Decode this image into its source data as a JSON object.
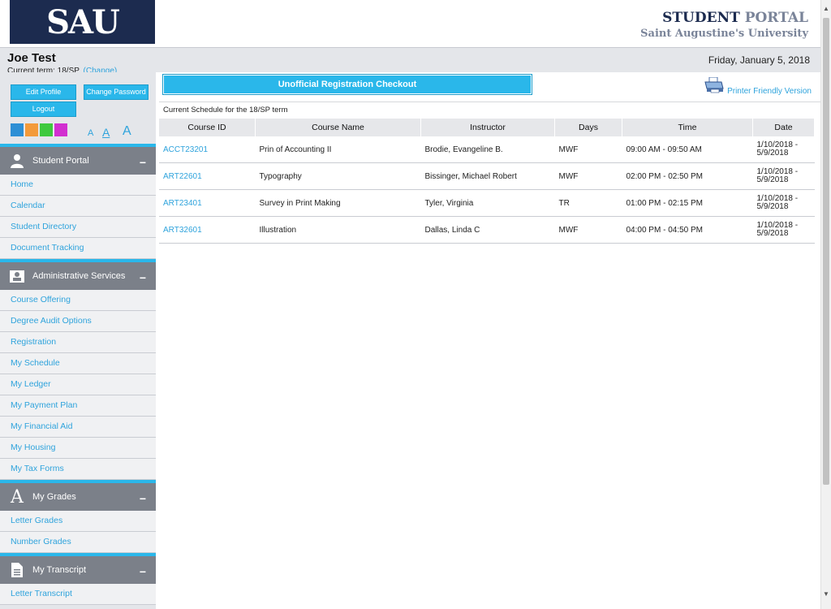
{
  "header": {
    "logo_text": "SAU",
    "portal_title_1": "STUDENT",
    "portal_title_2": "PORTAL",
    "university": "Saint Augustine's University"
  },
  "user": {
    "name": "Joe Test",
    "term_label": "Current term: 18/SP",
    "change_label": "(Change)",
    "date": "Friday, January 5, 2018"
  },
  "buttons": {
    "edit_profile": "Edit Profile",
    "change_password": "Change Password",
    "logout": "Logout"
  },
  "theme_colors": [
    "#2d8fd5",
    "#f39a3a",
    "#3ec93e",
    "#d22fd0"
  ],
  "font_sizes": [
    "A",
    "A",
    "A"
  ],
  "nav": {
    "student_portal": {
      "title": "Student Portal",
      "items": [
        "Home",
        "Calendar",
        "Student Directory",
        "Document Tracking"
      ]
    },
    "admin": {
      "title": "Administrative Services",
      "items": [
        "Course Offering",
        "Degree Audit Options",
        "Registration",
        "My Schedule",
        "My Ledger",
        "My Payment Plan",
        "My Financial Aid",
        "My Housing",
        "My Tax Forms"
      ]
    },
    "grades": {
      "title": "My Grades",
      "items": [
        "Letter Grades",
        "Number Grades"
      ]
    },
    "transcript": {
      "title": "My Transcript",
      "items": [
        "Letter Transcript"
      ]
    }
  },
  "main": {
    "checkout_title": "Unofficial Registration Checkout",
    "printer_link": "Printer Friendly Version",
    "schedule_caption": "Current Schedule for the 18/SP term",
    "columns": [
      "Course ID",
      "Course Name",
      "Instructor",
      "Days",
      "Time",
      "Date"
    ],
    "rows": [
      {
        "id": "ACCT23201",
        "name": "Prin of Accounting II",
        "instructor": "Brodie, Evangeline B.",
        "days": "MWF",
        "time": "09:00 AM - 09:50 AM",
        "date1": "1/10/2018 -",
        "date2": "5/9/2018"
      },
      {
        "id": "ART22601",
        "name": "Typography",
        "instructor": "Bissinger, Michael Robert",
        "days": "MWF",
        "time": "02:00 PM - 02:50 PM",
        "date1": "1/10/2018 -",
        "date2": "5/9/2018"
      },
      {
        "id": "ART23401",
        "name": "Survey in Print Making",
        "instructor": "Tyler, Virginia",
        "days": "TR",
        "time": "01:00 PM - 02:15 PM",
        "date1": "1/10/2018 -",
        "date2": "5/9/2018"
      },
      {
        "id": "ART32601",
        "name": "Illustration",
        "instructor": "Dallas, Linda C",
        "days": "MWF",
        "time": "04:00 PM - 04:50 PM",
        "date1": "1/10/2018 -",
        "date2": "5/9/2018"
      }
    ]
  }
}
